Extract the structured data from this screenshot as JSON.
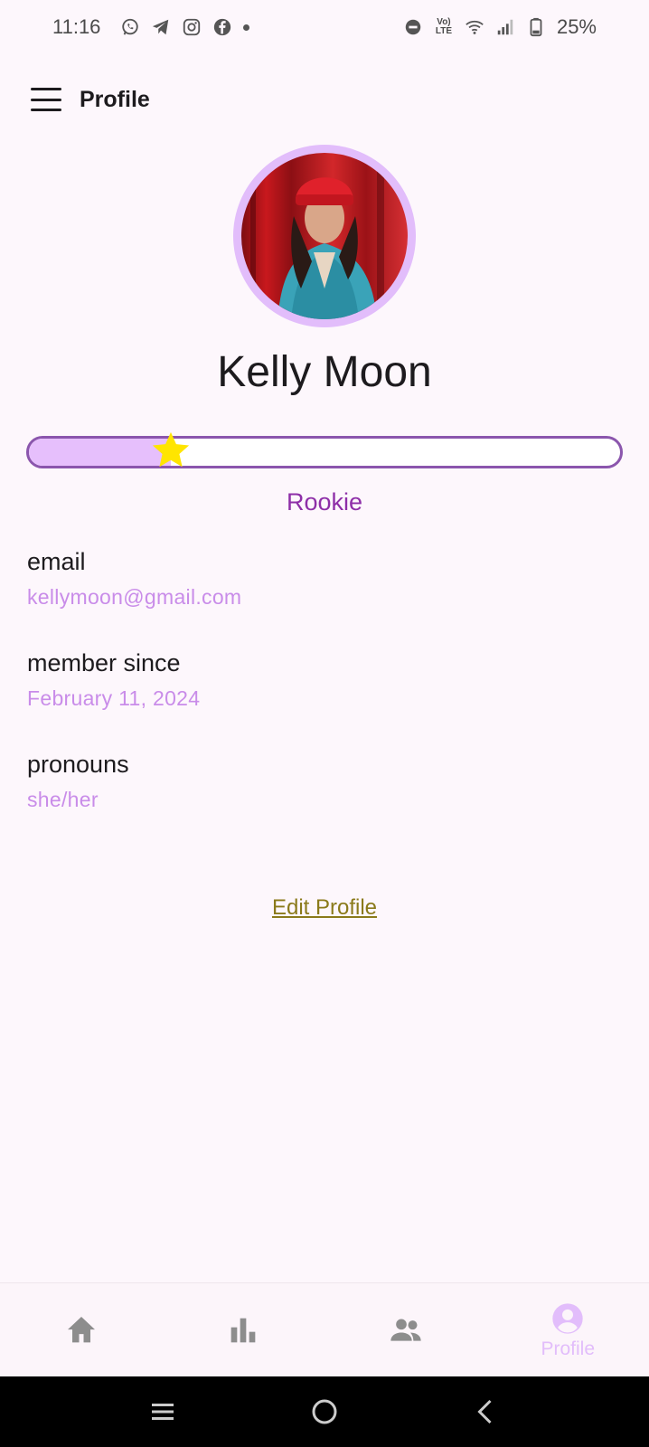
{
  "status_bar": {
    "time": "11:16",
    "battery": "25%",
    "lte_label": "Vo) LTE",
    "left_icons": [
      "whatsapp-icon",
      "telegram-icon",
      "instagram-icon",
      "facebook-icon",
      "dot-icon"
    ],
    "right_icons": [
      "do-not-disturb-icon",
      "volte-icon",
      "wifi-icon",
      "signal-icon",
      "battery-icon"
    ]
  },
  "app_bar": {
    "title": "Profile",
    "menu_icon": "hamburger-menu-icon"
  },
  "profile": {
    "name": "Kelly Moon",
    "avatar_icon": "profile-photo",
    "progress_fraction": 0.24,
    "rank": "Rookie",
    "fields": [
      {
        "label": "email",
        "value": "kellymoon@gmail.com"
      },
      {
        "label": "member since",
        "value": "February 11, 2024"
      },
      {
        "label": "pronouns",
        "value": "she/her"
      }
    ],
    "edit_label": "Edit Profile"
  },
  "bottom_nav": {
    "items": [
      {
        "icon": "home-icon",
        "label": ""
      },
      {
        "icon": "bar-chart-icon",
        "label": ""
      },
      {
        "icon": "people-icon",
        "label": ""
      },
      {
        "icon": "account-circle-icon",
        "label": "Profile"
      }
    ],
    "active_index": 3
  },
  "system_nav": [
    "recents-icon",
    "home-circle-icon",
    "back-icon"
  ],
  "colors": {
    "background": "#fdf7fc",
    "accent_light": "#e6bffc",
    "accent_border": "#8b56ad",
    "rank_text": "#8e2fa8",
    "field_value": "#c98ce9",
    "edit_link": "#8a7a1a",
    "star": "#ffe500",
    "nav_inactive": "#8d8d8d"
  }
}
